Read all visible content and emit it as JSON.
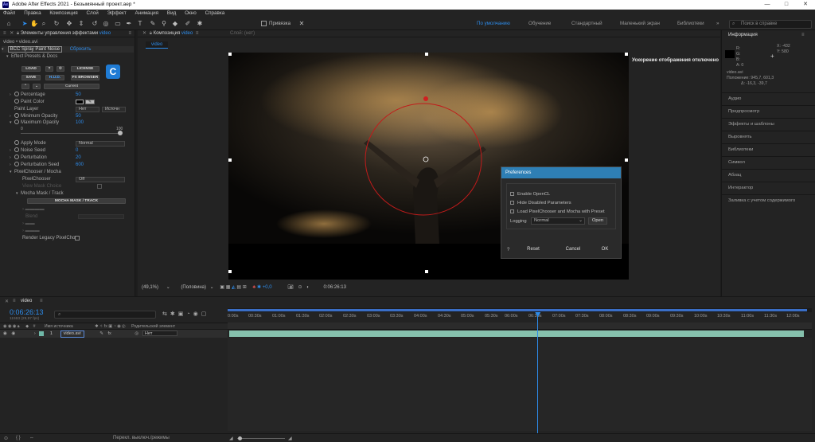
{
  "app": {
    "icon_text": "Ae",
    "title": "Adobe After Effects 2021 - Безымянный проект.aep *",
    "window_controls": [
      "—",
      "□",
      "✕"
    ]
  },
  "menu": [
    "Файл",
    "Правка",
    "Композиция",
    "Слой",
    "Эффект",
    "Анимация",
    "Вид",
    "Окно",
    "Справка"
  ],
  "toolbar": {
    "snap_label": "Привязка",
    "workspaces": [
      "По умолчанию",
      "Обучение",
      "Стандартный",
      "Маленький экран",
      "Библиотеки"
    ],
    "search_placeholder": "Поиск в справке"
  },
  "effects_panel": {
    "title": "Элементы управления эффектами",
    "title_file": "video",
    "layer_path": "video • video.avi",
    "fx_name": "BCC Spray Paint Noise",
    "reset_label": "Сбросить",
    "presets_label": "Effect Presets & Docs",
    "buttons": {
      "load": "LOAD",
      "help": "?",
      "gear": "⚙",
      "license": "LICENSE",
      "save": "SAVE",
      "hud": "H.U.D.",
      "fx_browser": "FX BROWSER",
      "current": "Current"
    },
    "params": {
      "percentage": {
        "label": "Percentage",
        "value": "50"
      },
      "paint_color": {
        "label": "Paint Color"
      },
      "paint_layer": {
        "label": "Paint Layer",
        "value": "Нет",
        "source": "Источн"
      },
      "min_opacity": {
        "label": "Minimum Opacity",
        "value": "50"
      },
      "max_opacity": {
        "label": "Maximum Opacity",
        "value": "100"
      },
      "slider_min": "0",
      "slider_max": "100",
      "apply_mode": {
        "label": "Apply Mode",
        "value": "Normal"
      },
      "noise_seed": {
        "label": "Noise Seed",
        "value": "0"
      },
      "perturbation": {
        "label": "Perturbation",
        "value": "20"
      },
      "perturbation_seed": {
        "label": "Perturbation Seed",
        "value": "600"
      },
      "pixelchooser_group": "PixelChooser / Mocha",
      "pixelchooser": {
        "label": "PixelChooser",
        "value": "Off"
      },
      "view_mask": "View Mask Choice",
      "mocha_group": "Mocha Mask / Track",
      "mocha_button": "MOCHA MASK / TRACK",
      "blend": "Blend",
      "render_legacy": "Render Legacy PixelCho"
    }
  },
  "composition": {
    "tab_label": "Композиция",
    "tab_name": "video",
    "subtab": "video",
    "layer_label": "Слой: (нет)",
    "gpu_message": "Ускорение отображения отключено",
    "zoom": "(49,1%)",
    "quality": "(Половина)",
    "exposure": "+0,0",
    "timecode": "0:06:26:13"
  },
  "preferences": {
    "title": "Preferences",
    "enable_opencl": "Enable OpenCL",
    "hide_disabled": "Hide Disabled Parameters",
    "load_pixelchooser": "Load PixelChooser and Mocha with Preset",
    "logging_label": "Logging",
    "logging_value": "Normal",
    "open": "Open",
    "help": "?",
    "reset": "Reset",
    "cancel": "Cancel",
    "ok": "OK"
  },
  "info_panel": {
    "title": "Информация",
    "r": "R:",
    "g": "G:",
    "b": "B:",
    "a": "A:",
    "a_val": "0",
    "x": "X: -432",
    "y": "Y: 580",
    "layer_file": "video.avi",
    "position": "Положение: 945,7, 601,3",
    "delta": "Δ: -16,3, -39,7"
  },
  "right_sections": [
    "Аудио",
    "Предпросмотр",
    "Эффекты и шаблоны",
    "Выровнять",
    "Библиотеки",
    "Символ",
    "Абзац",
    "Интерактор",
    "Заливка с учетом содержимого"
  ],
  "timeline": {
    "tab_name": "video",
    "timecode": "0:06:26:13",
    "frame_info": "11593 (29,97 fps)",
    "search_placeholder": "",
    "col_source": "Имя источника",
    "col_parent": "Родительский элемент",
    "layer_num": "1",
    "layer_name": "video.avi",
    "layer_parent": "Нет",
    "ruler": [
      "0:00s",
      "00:30s",
      "01:00s",
      "01:30s",
      "02:00s",
      "02:30s",
      "03:00s",
      "03:30s",
      "04:00s",
      "04:30s",
      "05:00s",
      "05:30s",
      "06:00s",
      "06:30s",
      "07:00s",
      "07:30s",
      "08:00s",
      "08:30s",
      "09:00s",
      "09:30s",
      "10:00s",
      "10:30s",
      "11:00s",
      "11:30s",
      "12:00s"
    ],
    "playhead_position": 0.535,
    "toggle_label": "Перекл. выключ./режимы"
  }
}
